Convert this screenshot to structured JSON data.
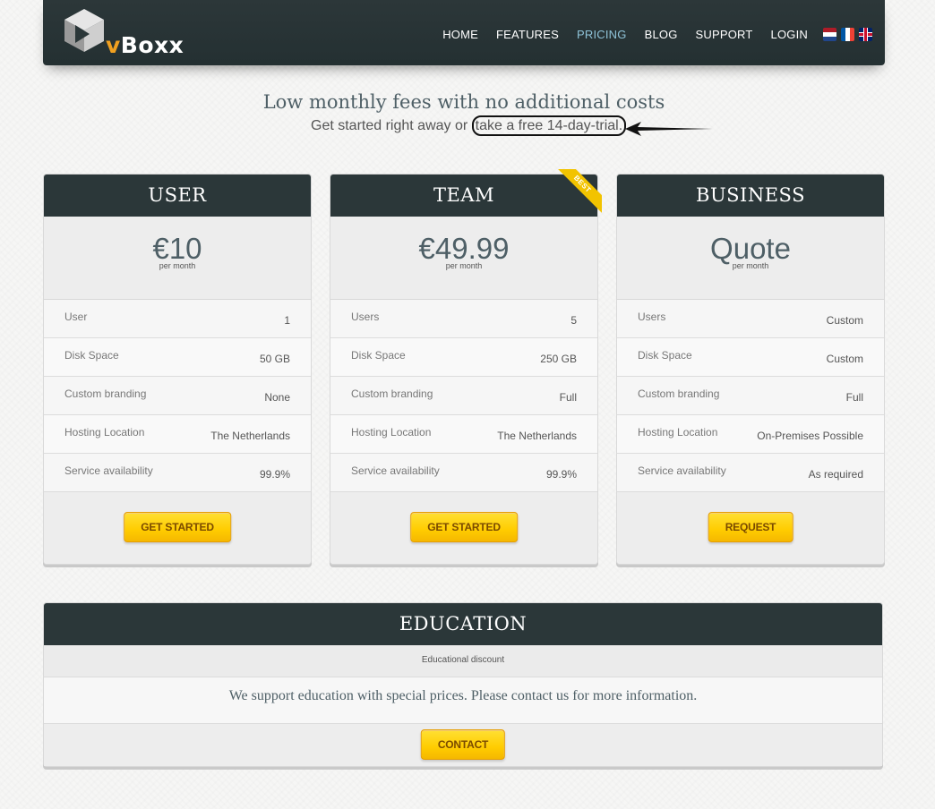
{
  "brand": {
    "logo_text_v": "v",
    "logo_text_rest": "Boxx"
  },
  "nav": {
    "items": [
      "HOME",
      "FEATURES",
      "PRICING",
      "BLOG",
      "SUPPORT",
      "LOGIN"
    ],
    "active": "PRICING",
    "colors": {
      "active": "#8fc3d8",
      "default": "#ffffff"
    }
  },
  "languages": [
    "nl-flag-icon",
    "fr-flag-icon",
    "uk-flag-icon"
  ],
  "intro": {
    "title": "Low monthly fees with no additional costs",
    "subtitle_prefix": "Get started right away or ",
    "trial_link": "take a free 14-day-trial."
  },
  "plans": [
    {
      "name": "USER",
      "price": "€10",
      "per": "per month",
      "features": [
        {
          "label": "User",
          "value": "1"
        },
        {
          "label": "Disk Space",
          "value": "50 GB"
        },
        {
          "label": "Custom branding",
          "value": "None"
        },
        {
          "label": "Hosting Location",
          "value": "The Netherlands"
        },
        {
          "label": "Service availability",
          "value": "99.9%"
        }
      ],
      "button": "GET STARTED"
    },
    {
      "name": "TEAM",
      "price": "€49.99",
      "per": "per month",
      "ribbon": "BEST",
      "features": [
        {
          "label": "Users",
          "value": "5"
        },
        {
          "label": "Disk Space",
          "value": "250 GB"
        },
        {
          "label": "Custom branding",
          "value": "Full"
        },
        {
          "label": "Hosting Location",
          "value": "The Netherlands"
        },
        {
          "label": "Service availability",
          "value": "99.9%"
        }
      ],
      "button": "GET STARTED"
    },
    {
      "name": "BUSINESS",
      "price": "Quote",
      "per": "per month",
      "features": [
        {
          "label": "Users",
          "value": "Custom"
        },
        {
          "label": "Disk Space",
          "value": "Custom"
        },
        {
          "label": "Custom branding",
          "value": "Full"
        },
        {
          "label": "Hosting Location",
          "value": "On-Premises Possible"
        },
        {
          "label": "Service availability",
          "value": "As required"
        }
      ],
      "button": "REQUEST"
    }
  ],
  "education": {
    "title": "EDUCATION",
    "subtitle": "Educational discount",
    "text": "We support education with special prices. Please contact us for more information.",
    "button": "CONTACT"
  },
  "colors": {
    "header_bg": "#2b3739",
    "button_yellow": "#ffcc00",
    "heading_text": "#4e5f66"
  }
}
